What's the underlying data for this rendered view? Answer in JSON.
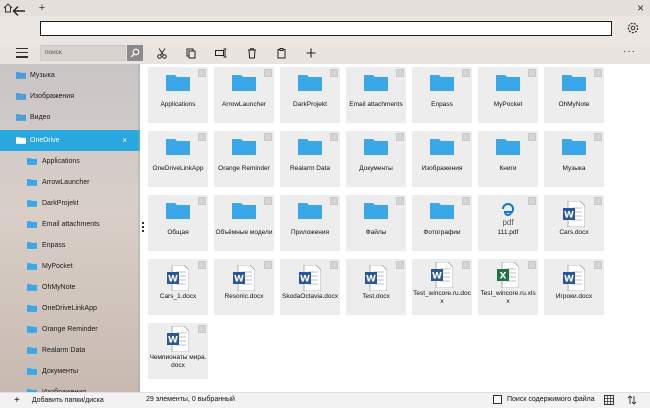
{
  "colors": {
    "accent": "#29a8e0",
    "folder": "#3aa8e8",
    "word": "#2b5797",
    "excel": "#1f7244",
    "edge": "#0f78d4"
  },
  "search": {
    "placeholder": "поиск"
  },
  "sidebar": {
    "top_items": [
      {
        "label": "Музыка"
      },
      {
        "label": "Изображения"
      },
      {
        "label": "Видео"
      }
    ],
    "selected": {
      "label": "OneDrive",
      "close": "×"
    },
    "children": [
      {
        "label": "Applications"
      },
      {
        "label": "ArrowLauncher"
      },
      {
        "label": "DarkProjekt"
      },
      {
        "label": "Email attachments"
      },
      {
        "label": "Enpass"
      },
      {
        "label": "MyPocket"
      },
      {
        "label": "OhMyNote"
      },
      {
        "label": "OneDriveLinkApp"
      },
      {
        "label": "Orange Reminder"
      },
      {
        "label": "Realarm Data"
      },
      {
        "label": "Документы"
      },
      {
        "label": "Изображения"
      }
    ],
    "add_folder": "Добавить папки/диска"
  },
  "files": [
    {
      "name": "Applications",
      "type": "folder"
    },
    {
      "name": "ArrowLauncher",
      "type": "folder"
    },
    {
      "name": "DarkProjekt",
      "type": "folder"
    },
    {
      "name": "Email attachments",
      "type": "folder"
    },
    {
      "name": "Enpass",
      "type": "folder"
    },
    {
      "name": "MyPocket",
      "type": "folder"
    },
    {
      "name": "OhMyNote",
      "type": "folder"
    },
    {
      "name": "OneDriveLinkApp",
      "type": "folder"
    },
    {
      "name": "Orange Reminder",
      "type": "folder"
    },
    {
      "name": "Realarm Data",
      "type": "folder"
    },
    {
      "name": "Документы",
      "type": "folder"
    },
    {
      "name": "Изображения",
      "type": "folder"
    },
    {
      "name": "Книги",
      "type": "folder"
    },
    {
      "name": "Музыка",
      "type": "folder"
    },
    {
      "name": "Общая",
      "type": "folder"
    },
    {
      "name": "Объёмные модели",
      "type": "folder"
    },
    {
      "name": "Приложения",
      "type": "folder"
    },
    {
      "name": "Файлы",
      "type": "folder"
    },
    {
      "name": "Фотографии",
      "type": "folder"
    },
    {
      "name": "111.pdf",
      "type": "pdf",
      "badge": "pdf"
    },
    {
      "name": "Cars.docx",
      "type": "docx"
    },
    {
      "name": "Cars_1.docx",
      "type": "docx"
    },
    {
      "name": "Resonic.docx",
      "type": "docx"
    },
    {
      "name": "SkodaOctavia.docx",
      "type": "docx"
    },
    {
      "name": "Test.docx",
      "type": "docx"
    },
    {
      "name": "Test_wincore.ru.docx",
      "type": "docx"
    },
    {
      "name": "Test_wincore.ru.xlsx",
      "type": "xlsx"
    },
    {
      "name": "Игроки.docx",
      "type": "docx"
    },
    {
      "name": "Чемпионаты мира.docx",
      "type": "docx"
    }
  ],
  "status": {
    "count": "29 элементы, 0 выбранный",
    "search_content": "Поиск содержимого файла"
  }
}
